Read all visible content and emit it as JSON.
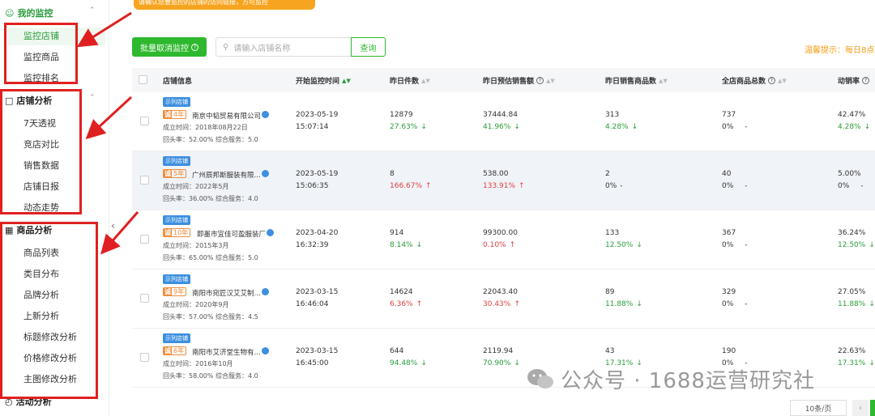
{
  "banner": {
    "text": "请确认您要监控的店铺的访问链接，方可监控"
  },
  "sidebar": {
    "groups": [
      {
        "title": "我的监控",
        "items": [
          "监控店铺",
          "监控商品",
          "监控排名"
        ]
      },
      {
        "title": "店铺分析",
        "items": [
          "7天透视",
          "竞店对比",
          "销售数据",
          "店铺日报",
          "动态走势"
        ]
      },
      {
        "title": "商品分析",
        "items": [
          "商品列表",
          "类目分布",
          "品牌分析",
          "上新分析",
          "标题修改分析",
          "价格修改分析",
          "主图修改分析"
        ]
      },
      {
        "title": "活动分析",
        "items": []
      }
    ],
    "active_item": "监控店铺"
  },
  "toolbar": {
    "batch_label": "批量取消监控",
    "search_placeholder": "请输入店铺名称",
    "search_button": "查询",
    "tip": "温馨提示：每日8点~"
  },
  "table": {
    "headers": [
      "店铺信息",
      "开始监控时间",
      "昨日件数",
      "昨日预估销售额",
      "昨日销售商品数",
      "全店商品总数",
      "动销率"
    ],
    "rows": [
      {
        "tag": "示列店铺",
        "years": "4年",
        "name": "南京中韬贸易有限公司",
        "founded": "成立时间：2018年08月22日",
        "service": "回头率：52.00%   综合服务：5.0",
        "date": "2023-05-19",
        "time": "15:07:14",
        "qty": "12879",
        "qty_chg": "27.63%",
        "qty_dir": "down",
        "sales": "37444.84",
        "sales_chg": "41.96%",
        "sales_dir": "down",
        "sold": "313",
        "sold_chg": "4.28%",
        "sold_dir": "down",
        "total": "737",
        "total_chg": "0%",
        "total_dir": "-",
        "rate": "42.47%",
        "rate_chg": "4.28%",
        "rate_dir": "down"
      },
      {
        "tag": "示列店铺",
        "years": "5年",
        "name": "广州辰邦斯服装有限...",
        "founded": "成立时间：2022年5月",
        "service": "回头率：36.00%   综合服务：4.0",
        "date": "2023-05-19",
        "time": "15:06:35",
        "qty": "8",
        "qty_chg": "166.67%",
        "qty_dir": "up",
        "sales": "538.00",
        "sales_chg": "133.91%",
        "sales_dir": "up",
        "sold": "2",
        "sold_chg": "0%",
        "sold_dir": "-",
        "total": "40",
        "total_chg": "0%",
        "total_dir": "-",
        "rate": "5.00%",
        "rate_chg": "0%",
        "rate_dir": "-"
      },
      {
        "tag": "示列店铺",
        "years": "10年",
        "name": "即墨市宜佳可盈服装厂",
        "founded": "成立时间：2015年3月",
        "service": "回头率：65.00%   综合服务：5.0",
        "date": "2023-04-20",
        "time": "16:32:39",
        "qty": "914",
        "qty_chg": "8.14%",
        "qty_dir": "down",
        "sales": "99300.00",
        "sales_chg": "0.10%",
        "sales_dir": "up",
        "sold": "133",
        "sold_chg": "12.50%",
        "sold_dir": "down",
        "total": "367",
        "total_chg": "0%",
        "total_dir": "-",
        "rate": "36.24%",
        "rate_chg": "12.50%",
        "rate_dir": "down"
      },
      {
        "tag": "示列店铺",
        "years": "9年",
        "name": "南阳市宛匠汉艾艾制...",
        "founded": "成立时间：2020年9月",
        "service": "回头率：57.00%   综合服务：4.5",
        "date": "2023-03-15",
        "time": "16:46:04",
        "qty": "14624",
        "qty_chg": "6.36%",
        "qty_dir": "up",
        "sales": "22043.40",
        "sales_chg": "30.43%",
        "sales_dir": "up",
        "sold": "89",
        "sold_chg": "11.88%",
        "sold_dir": "down",
        "total": "329",
        "total_chg": "0%",
        "total_dir": "-",
        "rate": "27.05%",
        "rate_chg": "11.88%",
        "rate_dir": "down"
      },
      {
        "tag": "示列店铺",
        "years": "6年",
        "name": "南阳市艾济堂生物有...",
        "founded": "成立时间：2016年10月",
        "service": "回头率：58.00%   综合服务：4.0",
        "date": "2023-03-15",
        "time": "16:45:00",
        "qty": "644",
        "qty_chg": "94.48%",
        "qty_dir": "down",
        "sales": "2119.94",
        "sales_chg": "70.90%",
        "sales_dir": "down",
        "sold": "43",
        "sold_chg": "17.31%",
        "sold_dir": "down",
        "total": "190",
        "total_chg": "0%",
        "total_dir": "-",
        "rate": "22.63%",
        "rate_chg": "17.31%",
        "rate_dir": "down"
      }
    ]
  },
  "watermark": {
    "text": "公众号 · 1688运营研究社"
  },
  "pager": {
    "page_size": "10条/页"
  },
  "colors": {
    "accent": "#2eb82e",
    "annotation": "#e02020",
    "up": "#e04040",
    "down": "#2a9d3a"
  }
}
